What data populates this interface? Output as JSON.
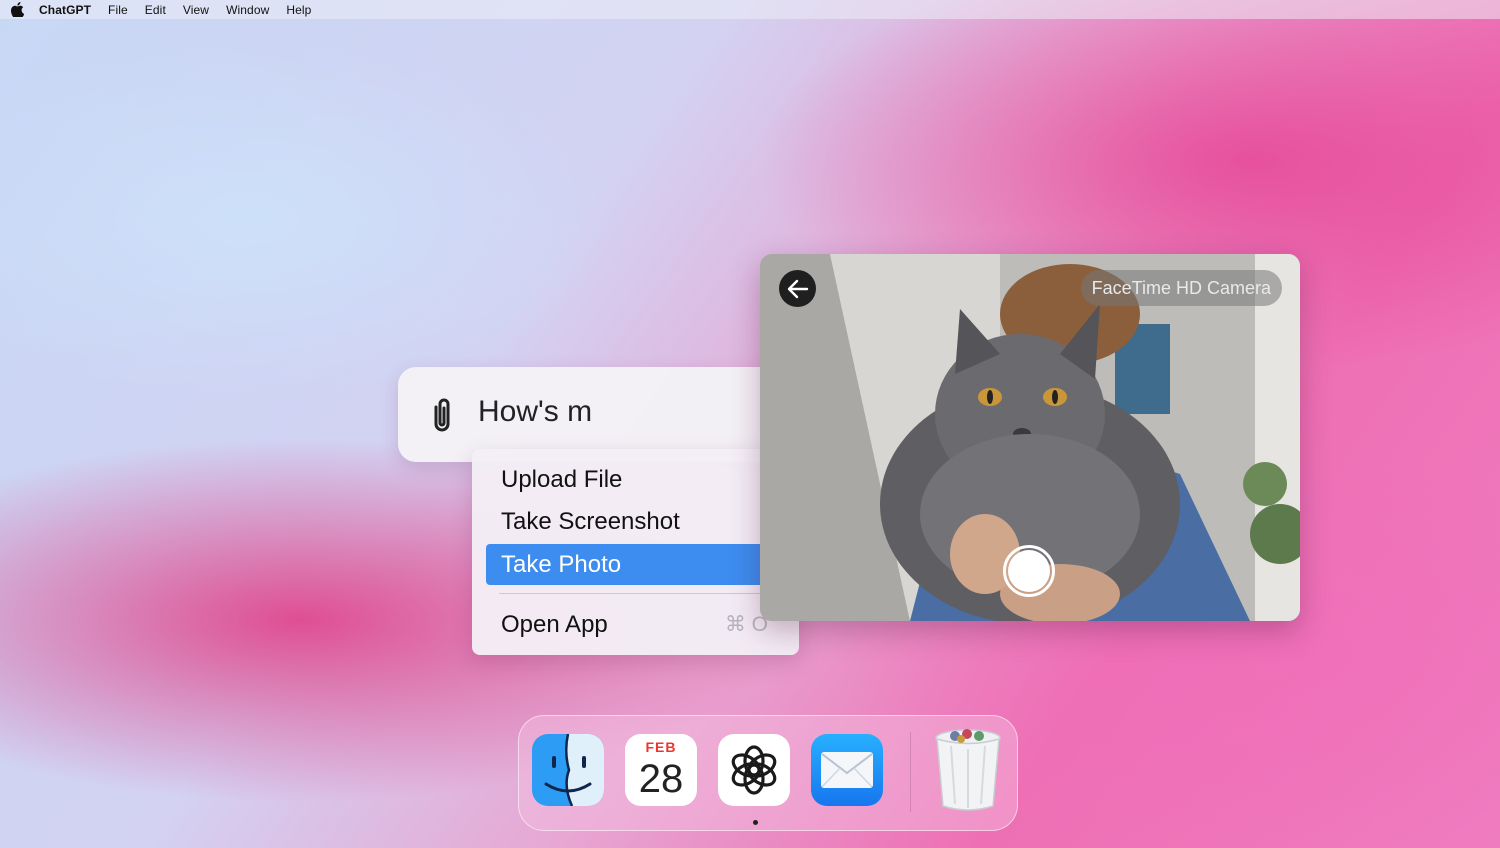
{
  "menubar": {
    "app_name": "ChatGPT",
    "items": [
      "File",
      "Edit",
      "View",
      "Window",
      "Help"
    ]
  },
  "chat": {
    "input_text": "How's m",
    "attach_icon": "paperclip-icon"
  },
  "attach_menu": {
    "items": [
      {
        "label": "Upload File",
        "active": false
      },
      {
        "label": "Take Screenshot",
        "active": false
      },
      {
        "label": "Take Photo",
        "active": true
      }
    ],
    "open_app": {
      "label": "Open App",
      "shortcut": "⌘ O"
    },
    "accent": "#3d8cef"
  },
  "camera": {
    "label": "FaceTime HD Camera",
    "back_icon": "back-arrow-icon",
    "shutter_icon": "shutter-button"
  },
  "dock": {
    "apps": [
      "finder-icon",
      "calendar-icon",
      "chatgpt-icon",
      "mail-icon"
    ],
    "calendar": {
      "month": "FEB",
      "day": "28"
    },
    "trash_icon": "trash-icon"
  }
}
